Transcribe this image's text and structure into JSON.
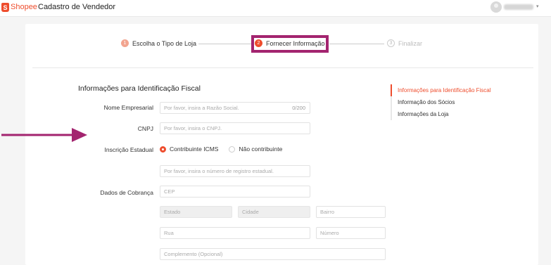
{
  "header": {
    "logo_letter": "S",
    "logo_text": "Shopee",
    "title": "Cadastro de Vendedor",
    "caret": "▾"
  },
  "stepper": {
    "steps": [
      {
        "num": "1",
        "label": "Escolha o Tipo de Loja"
      },
      {
        "num": "2",
        "label": "Fornecer Informação"
      },
      {
        "num": "3",
        "label": "Finalizar"
      }
    ]
  },
  "form": {
    "section_title": "Informações para Identificação Fiscal",
    "nome_label": "Nome Empresarial",
    "nome_placeholder": "Por favor, insira a Razão Social.",
    "nome_counter": "0/200",
    "cnpj_label": "CNPJ",
    "cnpj_placeholder": "Por favor, insira o CNPJ.",
    "ie_label": "Inscrição Estadual",
    "ie_options": [
      "Contribuinte ICMS",
      "Não contribuinte"
    ],
    "ie_placeholder": "Por favor, insira o número de registro estadual.",
    "cobranca_label": "Dados de Cobrança",
    "cep_placeholder": "CEP",
    "estado_placeholder": "Estado",
    "cidade_placeholder": "Cidade",
    "bairro_placeholder": "Bairro",
    "rua_placeholder": "Rua",
    "numero_placeholder": "Número",
    "complemento_placeholder": "Complemento (Opcional)"
  },
  "side_nav": {
    "items": [
      {
        "label": "Informações para Identificação Fiscal",
        "active": true
      },
      {
        "label": "Informação dos Sócios",
        "active": false
      },
      {
        "label": "Informações da Loja",
        "active": false
      }
    ]
  },
  "colors": {
    "brand": "#ee4d2d",
    "annotation": "#a3246f"
  }
}
